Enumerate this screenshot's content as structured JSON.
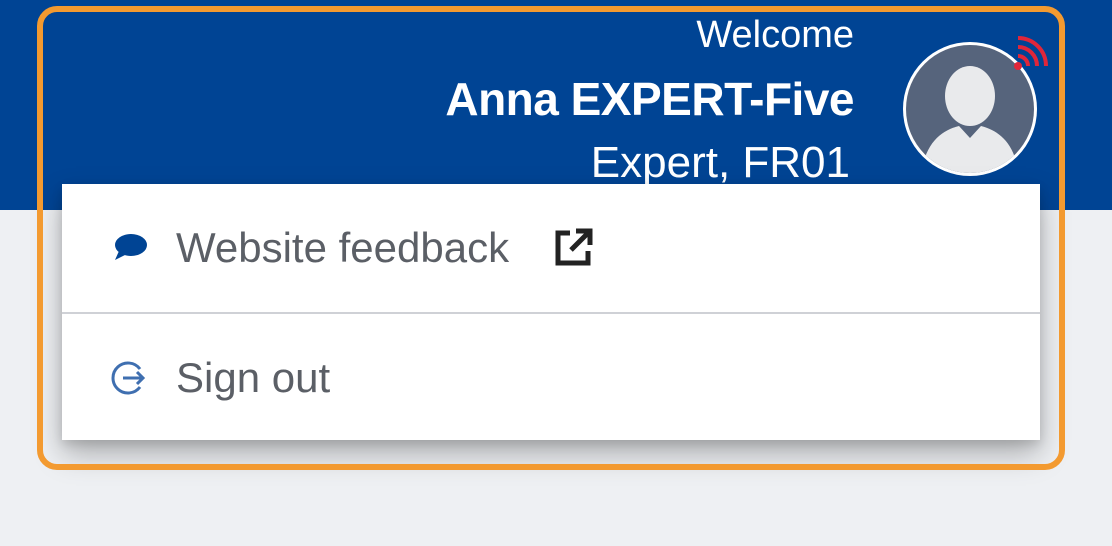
{
  "header": {
    "welcome": "Welcome",
    "user_name": "Anna EXPERT-Five",
    "user_role": "Expert, FR01",
    "bg_color": "#004494"
  },
  "avatar": {
    "icon": "user-avatar-icon",
    "badge_icon": "signal-icon",
    "badge_color": "#e0263a"
  },
  "menu": {
    "items": [
      {
        "label": "Website feedback",
        "icon": "speech-bubble-icon",
        "trailing_icon": "external-link-icon"
      },
      {
        "label": "Sign out",
        "icon": "sign-out-icon"
      }
    ]
  },
  "highlight_color": "#f39a30"
}
